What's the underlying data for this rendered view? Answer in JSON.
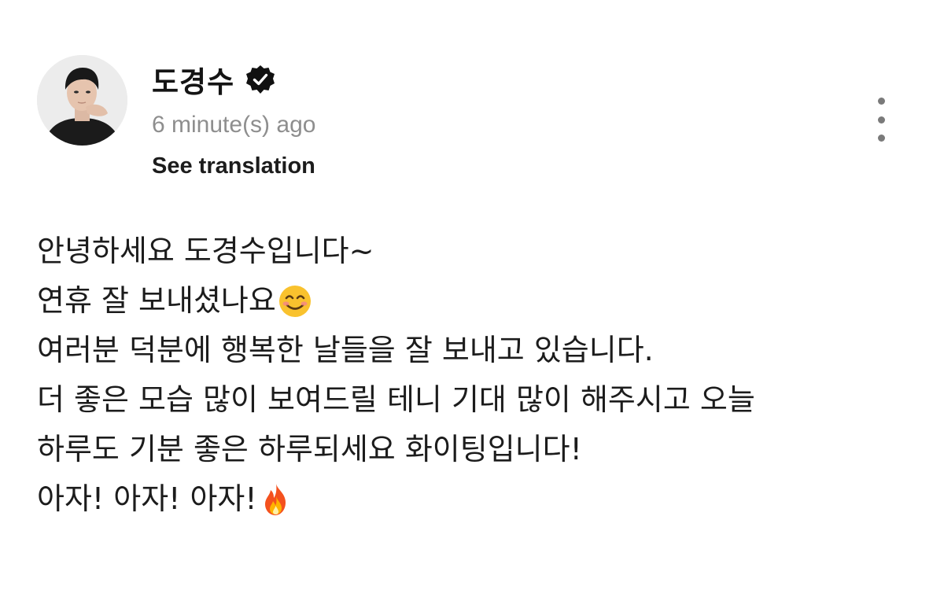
{
  "post": {
    "author": {
      "name": "도경수",
      "avatar_icon": "profile-photo",
      "verified_icon": "verified-badge-icon"
    },
    "timestamp": "6 minute(s) ago",
    "translate_label": "See translation",
    "menu_icon": "more-vertical-icon",
    "lines": [
      {
        "text": "안녕하세요 도경수입니다~"
      },
      {
        "text": "연휴 잘 보내셨나요",
        "emoji": "smiling-face-emoji"
      },
      {
        "text": "여러분 덕분에 행복한 날들을 잘 보내고 있습니다."
      },
      {
        "text": "더 좋은 모습 많이 보여드릴 테니 기대 많이 해주시고 오늘"
      },
      {
        "text": "하루도 기분 좋은 하루되세요 화이팅입니다!"
      },
      {
        "text": "아자! 아자! 아자!",
        "emoji": "fire-emoji"
      }
    ]
  },
  "colors": {
    "text": "#1c1c1c",
    "muted": "#8e8e8e",
    "background": "#ffffff"
  }
}
